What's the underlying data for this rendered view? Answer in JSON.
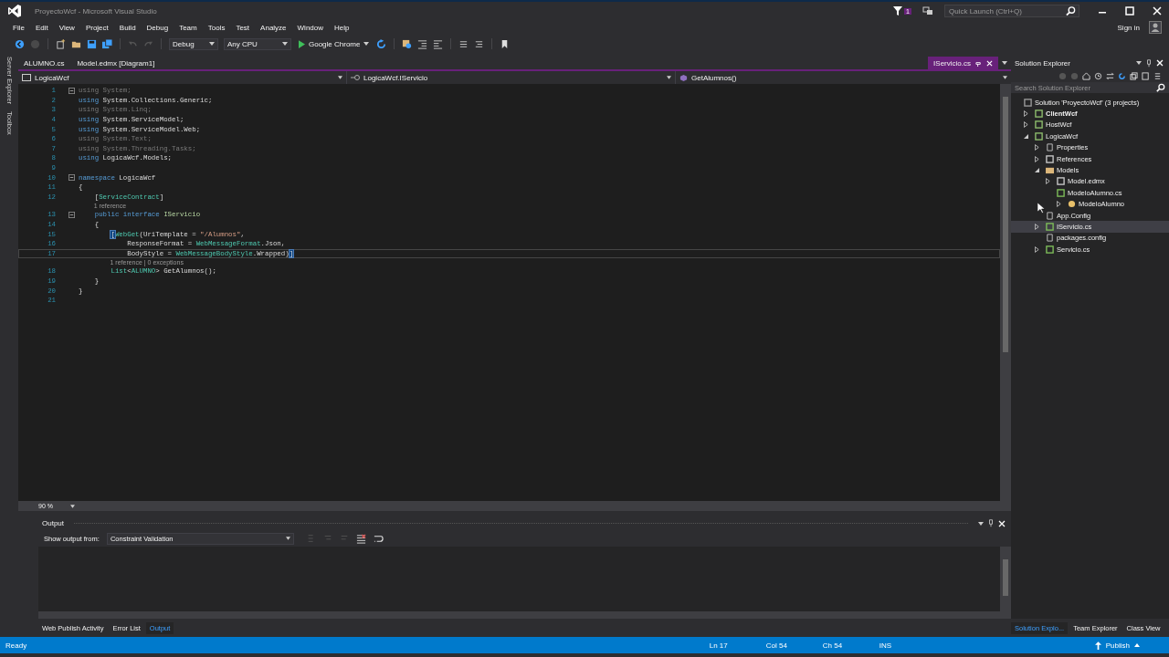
{
  "window": {
    "title": "ProyectoWcf - Microsoft Visual Studio",
    "notifications": "1",
    "quick_launch": {
      "placeholder": "Quick Launch (Ctrl+Q)"
    },
    "sign_in": "Sign in"
  },
  "menu": [
    "File",
    "Edit",
    "View",
    "Project",
    "Build",
    "Debug",
    "Team",
    "Tools",
    "Test",
    "Analyze",
    "Window",
    "Help"
  ],
  "toolbar": {
    "configuration": "Debug",
    "platform": "Any CPU",
    "run_target": "Google Chrome"
  },
  "side_tabs": [
    "Server Explorer",
    "Toolbox"
  ],
  "doc_tabs": [
    {
      "label": "ALUMNO.cs",
      "selected": false
    },
    {
      "label": "Model.edmx [Diagram1]",
      "selected": false
    },
    {
      "label": "IServicio.cs",
      "selected": true
    }
  ],
  "nav_bar": {
    "project": "LogicaWcf",
    "type": "LogicaWcf.IServicio",
    "member": "GetAlumnos()"
  },
  "code": [
    {
      "number": "1",
      "fold": true,
      "tokens": [
        {
          "kind": "unused",
          "text": "using System;"
        }
      ]
    },
    {
      "number": "2",
      "tokens": [
        {
          "kind": "keyword",
          "text": "using"
        },
        {
          "kind": "plain",
          "text": " System.Collections.Generic;"
        }
      ]
    },
    {
      "number": "3",
      "tokens": [
        {
          "kind": "unused",
          "text": "using System.Linq;"
        }
      ]
    },
    {
      "number": "4",
      "tokens": [
        {
          "kind": "keyword",
          "text": "using"
        },
        {
          "kind": "plain",
          "text": " System.ServiceModel;"
        }
      ]
    },
    {
      "number": "5",
      "tokens": [
        {
          "kind": "keyword",
          "text": "using"
        },
        {
          "kind": "plain",
          "text": " System.ServiceModel.Web;"
        }
      ]
    },
    {
      "number": "6",
      "tokens": [
        {
          "kind": "unused",
          "text": "using System.Text;"
        }
      ]
    },
    {
      "number": "7",
      "tokens": [
        {
          "kind": "unused",
          "text": "using System.Threading.Tasks;"
        }
      ]
    },
    {
      "number": "8",
      "tokens": [
        {
          "kind": "keyword",
          "text": "using"
        },
        {
          "kind": "plain",
          "text": " LogicaWcf.Models;"
        }
      ]
    },
    {
      "number": "9"
    },
    {
      "number": "10",
      "fold": true,
      "tokens": [
        {
          "kind": "keyword",
          "text": "namespace"
        },
        {
          "kind": "plain",
          "text": " LogicaWcf"
        }
      ]
    },
    {
      "number": "11",
      "tokens": [
        {
          "kind": "plain",
          "text": "{"
        }
      ]
    },
    {
      "number": "12",
      "tokens": [
        {
          "kind": "plain",
          "text": "    ["
        },
        {
          "kind": "type",
          "text": "ServiceContract"
        },
        {
          "kind": "plain",
          "text": "]"
        }
      ]
    },
    {
      "kind": "lens",
      "text": "1 reference"
    },
    {
      "number": "13",
      "fold": true,
      "tokens": [
        {
          "kind": "keyword",
          "text": "    public"
        },
        {
          "kind": "keyword",
          "text": " interface"
        },
        {
          "kind": "interface",
          "text": " IServicio"
        }
      ]
    },
    {
      "number": "14",
      "tokens": [
        {
          "kind": "plain",
          "text": "    {"
        }
      ]
    },
    {
      "number": "15",
      "tokens": [
        {
          "kind": "match",
          "text": "        ["
        },
        {
          "kind": "type",
          "text": "WebGet"
        },
        {
          "kind": "plain",
          "text": "(UriTemplate = "
        },
        {
          "kind": "string",
          "text": "\"/Alumnos\""
        },
        {
          "kind": "plain",
          "text": ","
        }
      ]
    },
    {
      "number": "16",
      "tokens": [
        {
          "kind": "plain",
          "text": "            ResponseFormat = "
        },
        {
          "kind": "type",
          "text": "WebMessageFormat"
        },
        {
          "kind": "plain",
          "text": ".Json,"
        }
      ]
    },
    {
      "number": "17",
      "current": true,
      "tokens": [
        {
          "kind": "plain",
          "text": "            BodyStyle = "
        },
        {
          "kind": "type",
          "text": "WebMessageBodyStyle"
        },
        {
          "kind": "plain",
          "text": ".Wrapped)"
        },
        {
          "kind": "match",
          "text": "]"
        }
      ]
    },
    {
      "kind": "lens",
      "text": "1 reference | 0 exceptions"
    },
    {
      "number": "18",
      "tokens": [
        {
          "kind": "type",
          "text": "        List"
        },
        {
          "kind": "plain",
          "text": "<"
        },
        {
          "kind": "type",
          "text": "ALUMNO"
        },
        {
          "kind": "plain",
          "text": "> GetAlumnos();"
        }
      ]
    },
    {
      "number": "19",
      "tokens": [
        {
          "kind": "plain",
          "text": "    }"
        }
      ]
    },
    {
      "number": "20",
      "tokens": [
        {
          "kind": "plain",
          "text": "}"
        }
      ]
    },
    {
      "number": "21"
    }
  ],
  "zoom": "90 %",
  "output": {
    "title": "Output",
    "source_label": "Show output from:",
    "source": "Constraint Validation"
  },
  "bottom_tabs": [
    {
      "label": "Web Publish Activity",
      "selected": false
    },
    {
      "label": "Error List",
      "selected": false
    },
    {
      "label": "Output",
      "selected": true
    }
  ],
  "solution_explorer": {
    "title": "Solution Explorer",
    "search": {
      "placeholder": "Search Solution Explorer"
    },
    "tree": [
      {
        "label": "Solution 'ProyectoWcf' (3 projects)",
        "kind": "solution",
        "selected": false,
        "children": [
          {
            "label": "ClientWcf",
            "kind": "project",
            "bold": true,
            "expanded": false,
            "selected": false
          },
          {
            "label": "HostWcf",
            "kind": "project",
            "expanded": false,
            "selected": false
          },
          {
            "label": "LogicaWcf",
            "kind": "project",
            "expanded": true,
            "selected": false,
            "children": [
              {
                "label": "Properties",
                "kind": "properties",
                "expanded": false,
                "selected": false
              },
              {
                "label": "References",
                "kind": "references",
                "expanded": false,
                "selected": false
              },
              {
                "label": "Models",
                "kind": "folder",
                "expanded": true,
                "selected": false,
                "children": [
                  {
                    "label": "Model.edmx",
                    "kind": "edmx",
                    "expanded": false,
                    "selected": false
                  },
                  {
                    "label": "ModeloAlumno.cs",
                    "kind": "cs",
                    "selected": false,
                    "children": [
                      {
                        "label": "ModeloAlumno",
                        "kind": "class",
                        "expanded": false,
                        "selected": false
                      }
                    ]
                  }
                ]
              },
              {
                "label": "App.Config",
                "kind": "config",
                "selected": false
              },
              {
                "label": "IServicio.cs",
                "kind": "cs",
                "expanded": false,
                "selected": true
              },
              {
                "label": "packages.config",
                "kind": "config",
                "selected": false
              },
              {
                "label": "Servicio.cs",
                "kind": "cs",
                "expanded": false,
                "selected": false
              }
            ]
          }
        ]
      }
    ]
  },
  "right_tabs": [
    {
      "label": "Solution Explo...",
      "selected": true
    },
    {
      "label": "Team Explorer",
      "selected": false
    },
    {
      "label": "Class View",
      "selected": false
    }
  ],
  "status_bar": {
    "state": "Ready",
    "line": "Ln 17",
    "column": "Col 54",
    "char": "Ch 54",
    "mode": "INS",
    "publish": "Publish"
  }
}
